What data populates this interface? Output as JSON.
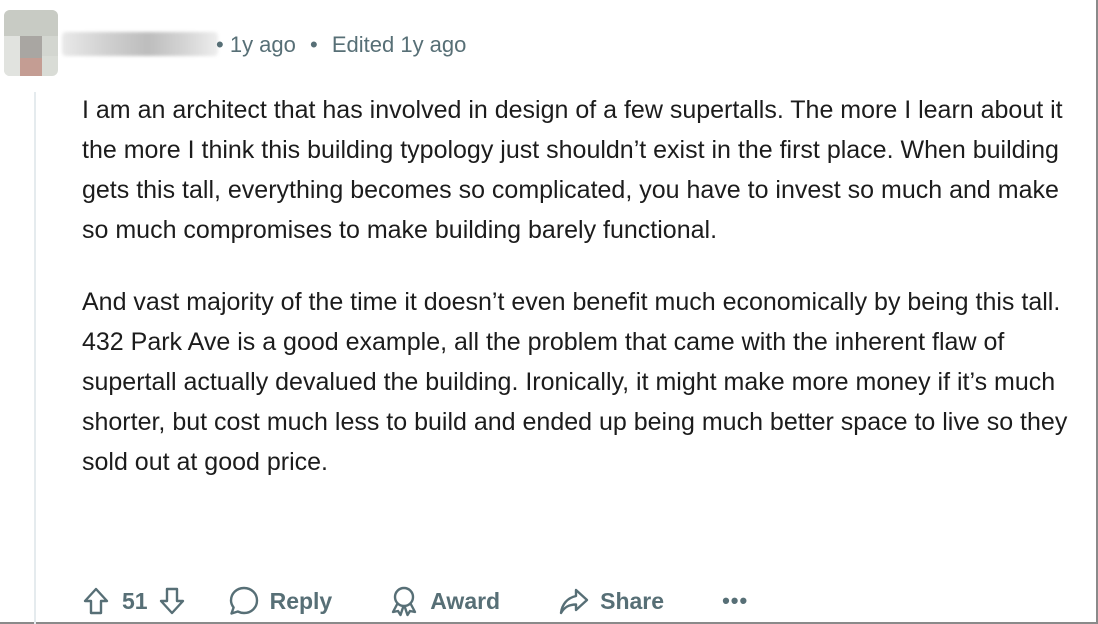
{
  "comment": {
    "username": "",
    "time_ago": "1y ago",
    "separator": "•",
    "edited": "Edited 1y ago",
    "paragraphs": [
      "I am an architect that has involved in design of a few supertalls. The more I learn about it the more I think this building typology just shouldn’t exist in the first place. When building gets this tall, everything becomes so complicated, you have to invest so much and make so much compromises to make building barely functional.",
      "And vast majority of the time it doesn’t even benefit much economically by being this tall. 432 Park Ave is a good example, all the problem that came with the inherent flaw of supertall actually devalued the building. Ironically, it might make more money if it’s much shorter, but cost much less to build and ended up being much better space to live so they sold out at good price."
    ]
  },
  "actions": {
    "score": "51",
    "reply_label": "Reply",
    "award_label": "Award",
    "share_label": "Share",
    "more_label": "•••"
  },
  "icons": {
    "upvote": "upvote-arrow-icon",
    "downvote": "downvote-arrow-icon",
    "reply": "speech-bubble-icon",
    "award": "award-ribbon-icon",
    "share": "share-arrow-icon"
  },
  "colors": {
    "meta_text": "#576f76",
    "body_text": "#1c1c1c"
  }
}
